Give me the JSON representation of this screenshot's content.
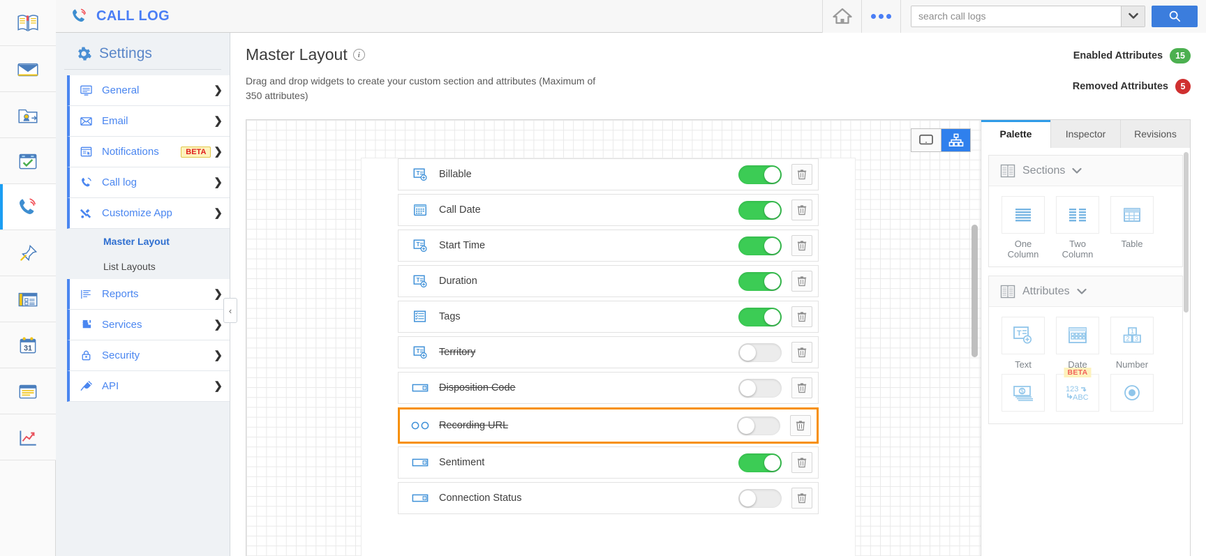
{
  "app": {
    "brand_title": "CALL LOG",
    "rail_items": [
      {
        "name": "notes-book",
        "label": "Notebook"
      },
      {
        "name": "mail",
        "label": "Email"
      },
      {
        "name": "contacts",
        "label": "Contacts"
      },
      {
        "name": "tasks",
        "label": "Tasks"
      },
      {
        "name": "call-log",
        "label": "Call Log",
        "active": true
      },
      {
        "name": "pin",
        "label": "Pinned"
      },
      {
        "name": "cards",
        "label": "Cards"
      },
      {
        "name": "calendar",
        "label": "Calendar",
        "day": "31"
      },
      {
        "name": "notes",
        "label": "Notes"
      },
      {
        "name": "analytics",
        "label": "Analytics"
      }
    ]
  },
  "topbar": {
    "home_label": "Home",
    "more_label": "More",
    "search_placeholder": "search call logs",
    "search_value": "",
    "search_button_label": "Search"
  },
  "settings": {
    "title": "Settings",
    "items": [
      {
        "label": "General",
        "icon": "monitor-icon",
        "expanded": false
      },
      {
        "label": "Email",
        "icon": "envelope-icon",
        "expanded": false
      },
      {
        "label": "Notifications",
        "icon": "notification-icon",
        "badge": "BETA",
        "expanded": false
      },
      {
        "label": "Call log",
        "icon": "phone-icon",
        "expanded": false
      },
      {
        "label": "Customize App",
        "icon": "tools-icon",
        "expanded": true
      }
    ],
    "submenu": [
      {
        "label": "Master Layout",
        "active": true
      },
      {
        "label": "List Layouts",
        "active": false
      }
    ],
    "items_after": [
      {
        "label": "Reports",
        "icon": "report-icon",
        "expanded": false
      },
      {
        "label": "Services",
        "icon": "puzzle-icon",
        "expanded": false
      },
      {
        "label": "Security",
        "icon": "lock-icon",
        "expanded": false
      },
      {
        "label": "API",
        "icon": "plug-icon",
        "expanded": false
      }
    ],
    "collapse_label": "‹"
  },
  "page": {
    "title": "Master Layout",
    "subtitle": "Drag and drop widgets to create your custom section and attributes (Maximum of 350 attributes)",
    "stats": [
      {
        "label": "Enabled Attributes",
        "value": "15",
        "color": "#4cb050",
        "style": "green"
      },
      {
        "label": "Removed Attributes",
        "value": "5",
        "color": "#cf3030",
        "style": "red"
      }
    ]
  },
  "canvas": {
    "view_modes": [
      {
        "name": "desktop-view",
        "active": false
      },
      {
        "name": "structure-view",
        "active": true
      }
    ],
    "attributes": [
      {
        "name": "Billable",
        "icon": "text-field-icon",
        "enabled": true,
        "removed": false,
        "selected": false
      },
      {
        "name": "Call Date",
        "icon": "date-field-icon",
        "enabled": true,
        "removed": false,
        "selected": false
      },
      {
        "name": "Start Time",
        "icon": "text-field-icon",
        "enabled": true,
        "removed": false,
        "selected": false
      },
      {
        "name": "Duration",
        "icon": "text-field-icon",
        "enabled": true,
        "removed": false,
        "selected": false
      },
      {
        "name": "Tags",
        "icon": "multiselect-icon",
        "enabled": true,
        "removed": false,
        "selected": false
      },
      {
        "name": "Territory",
        "icon": "text-field-icon",
        "enabled": false,
        "removed": true,
        "selected": false
      },
      {
        "name": "Disposition Code",
        "icon": "dropdown-icon",
        "enabled": false,
        "removed": true,
        "selected": false
      },
      {
        "name": "Recording URL",
        "icon": "link-icon",
        "enabled": false,
        "removed": true,
        "selected": true
      },
      {
        "name": "Sentiment",
        "icon": "dropdown-icon",
        "enabled": true,
        "removed": false,
        "selected": false
      },
      {
        "name": "Connection Status",
        "icon": "dropdown-icon",
        "enabled": false,
        "removed": false,
        "selected": false
      }
    ],
    "delete_label": "Delete"
  },
  "palette": {
    "tabs": [
      {
        "label": "Palette",
        "active": true
      },
      {
        "label": "Inspector",
        "active": false
      },
      {
        "label": "Revisions",
        "active": false
      }
    ],
    "groups": [
      {
        "title": "Sections",
        "icon": "sections-icon",
        "items": [
          {
            "label": "One Column",
            "icon": "one-column-icon"
          },
          {
            "label": "Two Column",
            "icon": "two-column-icon"
          },
          {
            "label": "Table",
            "icon": "table-icon"
          }
        ]
      },
      {
        "title": "Attributes",
        "icon": "attributes-icon",
        "items": [
          {
            "label": "Text",
            "icon": "text-field-icon"
          },
          {
            "label": "Date",
            "icon": "date-field-icon"
          },
          {
            "label": "Number",
            "icon": "number-icon"
          },
          {
            "label": "",
            "icon": "currency-icon"
          },
          {
            "label": "",
            "icon": "lookup-icon",
            "badge": "BETA"
          },
          {
            "label": "",
            "icon": "radio-icon"
          }
        ]
      }
    ]
  }
}
